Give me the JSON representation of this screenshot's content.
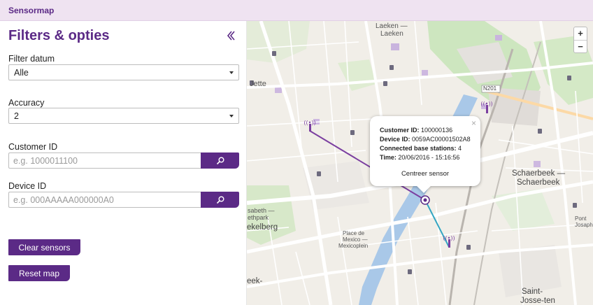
{
  "app": {
    "title": "Sensormap"
  },
  "sidebar": {
    "title": "Filters & opties",
    "filter_date": {
      "label": "Filter datum",
      "value": "Alle"
    },
    "accuracy": {
      "label": "Accuracy",
      "value": "2"
    },
    "customer_id": {
      "label": "Customer ID",
      "placeholder": "e.g. 1000011100"
    },
    "device_id": {
      "label": "Device ID",
      "placeholder": "e.g. 000AAAAA000000A0"
    },
    "clear_label": "Clear sensors",
    "reset_label": "Reset map"
  },
  "map": {
    "zoom_in": "+",
    "zoom_out": "−",
    "labels": {
      "laeken1": "Laeken —",
      "laeken2": "Laeken",
      "jette": "Jette",
      "n201": "N201",
      "schaerbeek1": "Schaerbeek —",
      "schaerbeek2": "Schaerbeek",
      "place1": "Place de",
      "place2": "Mexico —",
      "place3": "Mexicoplein",
      "saint1": "Saint-",
      "saint2": "Josse-ten",
      "elisabeth1": "sabeth —",
      "elisabeth2": "ethpark",
      "koekelberg": "ekelberg",
      "beek": "eek-",
      "pont1": "Pont",
      "pont2": "Josaph"
    },
    "popup": {
      "customer_label": "Customer ID:",
      "customer_value": "100000136",
      "device_label": "Device ID:",
      "device_value": "0059AC00001502A8",
      "stations_label": "Connected base stations:",
      "stations_value": "4",
      "time_label": "Time:",
      "time_value": "20/06/2016 - 15:16:56",
      "center_label": "Centreer sensor",
      "close": "×"
    }
  },
  "colors": {
    "brand": "#5b2a86",
    "sensor_line": "#7b3fa0",
    "sensor_line_2": "#29b6c8"
  }
}
